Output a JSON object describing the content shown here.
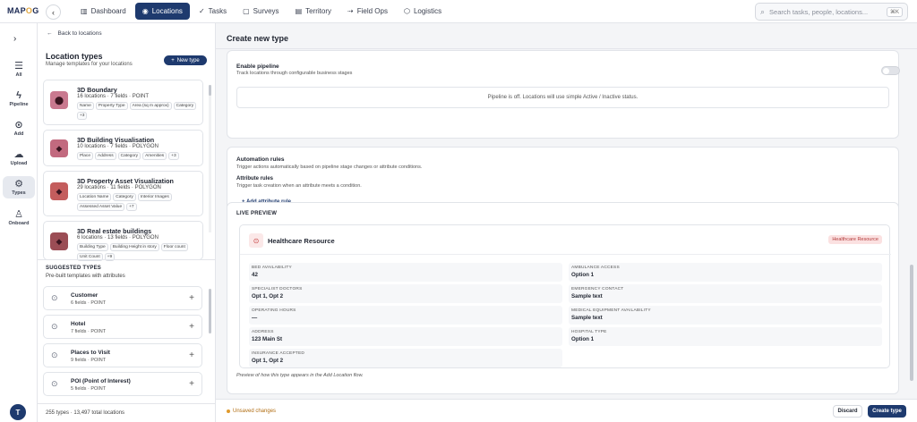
{
  "app": {
    "logo": "MAP",
    "logo_o": "O",
    "logo_tail": "G"
  },
  "nav": [
    {
      "label": "Dashboard",
      "icon": "▥"
    },
    {
      "label": "Locations",
      "icon": "◉"
    },
    {
      "label": "Tasks",
      "icon": "✓"
    },
    {
      "label": "Surveys",
      "icon": "▢"
    },
    {
      "label": "Territory",
      "icon": "▤"
    },
    {
      "label": "Field Ops",
      "icon": "⇢"
    },
    {
      "label": "Logistics",
      "icon": "⬡"
    }
  ],
  "search": {
    "placeholder": "Search tasks, people, locations...",
    "shortcut": "⌘K"
  },
  "rail": [
    {
      "label": "All",
      "icon": "☰"
    },
    {
      "label": "Pipeline",
      "icon": "ϟ"
    },
    {
      "label": "Add",
      "icon": "⊙"
    },
    {
      "label": "Upload",
      "icon": "☁"
    },
    {
      "label": "Types",
      "icon": "⚙"
    },
    {
      "label": "Onboard",
      "icon": "♙"
    }
  ],
  "user_initial": "T",
  "left": {
    "back": "Back to locations",
    "title": "Location types",
    "subtitle": "Manage templates for your locations",
    "new_type": "New type",
    "types": [
      {
        "name": "3D Boundary",
        "meta": "16 locations · 7 fields · POINT",
        "color": "#c9798f",
        "tags": [
          "Name",
          "Property Type",
          "Area (sq m approx)",
          "Category",
          "+3"
        ]
      },
      {
        "name": "3D Building Visualisation",
        "meta": "10 locations · 7 fields · POLYGON",
        "color": "#c26a7f",
        "tags": [
          "Place",
          "Address",
          "Category",
          "Amenities",
          "+3"
        ]
      },
      {
        "name": "3D Property Asset Visualization",
        "meta": "29 locations · 11 fields · POLYGON",
        "color": "#c45d5d",
        "tags": [
          "Location Name",
          "Category",
          "Interior Images",
          "Assessed Asset Value",
          "+7"
        ]
      },
      {
        "name": "3D Real estate buildings",
        "meta": "6 locations · 13 fields · POLYGON",
        "color": "#9b4d55",
        "tags": [
          "Building Type",
          "Building Height in story",
          "Floor count",
          "Unit Count",
          "+9"
        ]
      }
    ],
    "suggested_title": "SUGGESTED TYPES",
    "suggested_sub": "Pre-built templates with attributes",
    "suggested": [
      {
        "name": "Customer",
        "meta": "6 fields · POINT"
      },
      {
        "name": "Hotel",
        "meta": "7 fields · POINT"
      },
      {
        "name": "Places to Visit",
        "meta": "9 fields · POINT"
      },
      {
        "name": "POI (Point of Interest)",
        "meta": "5 fields · POINT"
      }
    ],
    "footer": "255 types · 13,497 total locations"
  },
  "main": {
    "title": "Create new type",
    "pipeline": {
      "label": "Enable pipeline",
      "sub": "Track locations through configurable business stages",
      "off_text": "Pipeline is off. Locations will use simple Active / Inactive status."
    },
    "automation": {
      "label": "Automation rules",
      "sub": "Trigger actions automatically based on pipeline stage changes or attribute conditions.",
      "attr_label": "Attribute rules",
      "attr_sub": "Trigger task creation when an attribute meets a condition.",
      "add_rule": "+ Add attribute rule"
    },
    "preview": {
      "title": "LIVE PREVIEW",
      "name": "Healthcare Resource",
      "badge": "Healthcare Resource",
      "fields": [
        {
          "k": "BED AVAILABILITY",
          "v": "42"
        },
        {
          "k": "AMBULANCE ACCESS",
          "v": "Option 1"
        },
        {
          "k": "SPECIALIST DOCTORS",
          "v": "Opt 1, Opt 2"
        },
        {
          "k": "EMERGENCY CONTACT",
          "v": "Sample text"
        },
        {
          "k": "OPERATING HOURS",
          "v": "—"
        },
        {
          "k": "MEDICAL EQUIPMENT AVAILABILITY",
          "v": "Sample text"
        },
        {
          "k": "ADDRESS",
          "v": "123 Main St"
        },
        {
          "k": "HOSPITAL TYPE",
          "v": "Option 1"
        },
        {
          "k": "INSURANCE ACCEPTED",
          "v": "Opt 1, Opt 2"
        }
      ],
      "caption": "Preview of how this type appears in the Add Location flow."
    },
    "unsaved": "Unsaved changes",
    "discard": "Discard",
    "create": "Create type"
  }
}
